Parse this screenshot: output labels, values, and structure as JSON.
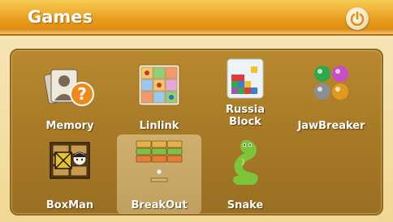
{
  "header": {
    "title": "Games",
    "power_icon": "power-icon"
  },
  "games": [
    {
      "label": "Memory",
      "icon": "memory-icon"
    },
    {
      "label": "Linlink",
      "icon": "linlink-icon"
    },
    {
      "label": "Russia Block",
      "icon": "russia-block-icon"
    },
    {
      "label": "JawBreaker",
      "icon": "jawbreaker-icon"
    },
    {
      "label": "BoxMan",
      "icon": "boxman-icon"
    },
    {
      "label": "BreakOut",
      "icon": "breakout-icon",
      "selected": true
    },
    {
      "label": "Snake",
      "icon": "snake-icon"
    }
  ],
  "colors": {
    "title_bar": "#e89b1a",
    "panel": "#a77a27",
    "background": "#f1d894",
    "label": "#ffffff"
  }
}
